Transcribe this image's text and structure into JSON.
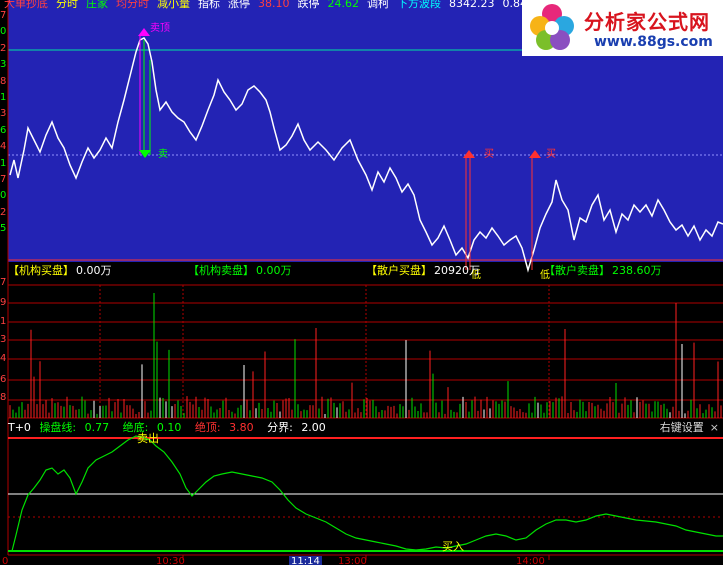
{
  "header": {
    "items": [
      {
        "text": "大单抄底",
        "color": "#ff4040"
      },
      {
        "text": "分时",
        "color": "#ffff00"
      },
      {
        "text": "庄家",
        "color": "#00ff00"
      },
      {
        "text": "均分时",
        "color": "#ff4040"
      },
      {
        "text": "减小量",
        "color": "#ffff00"
      },
      {
        "text": "指标",
        "color": "#ffffff"
      },
      {
        "text": "涨停",
        "color": "#ffffff"
      },
      {
        "text": "38.10",
        "color": "#ff4040"
      },
      {
        "text": "跌停",
        "color": "#ffffff"
      },
      {
        "text": "24.62",
        "color": "#00ff00"
      },
      {
        "text": "调柯",
        "color": "#ffffff"
      },
      {
        "text": "下方波段",
        "color": "#00ffff"
      },
      {
        "text": "8342.23",
        "color": "#ffffff"
      },
      {
        "text": "0.84",
        "color": "#ffffff"
      }
    ]
  },
  "logo": {
    "title": "分析家公式网",
    "url": "www.88gs.com"
  },
  "annotations": {
    "top": "卖顶",
    "sell": "卖",
    "buy1": "买",
    "buy2": "买",
    "base1": "低",
    "base2": "低"
  },
  "summary": [
    {
      "label": "【机构买盘】",
      "value": "0.00万",
      "label_color": "#ffff00",
      "value_color": "#ffffff"
    },
    {
      "label": "【机构卖盘】",
      "value": "0.00万",
      "label_color": "#00ff00",
      "value_color": "#00ff00"
    },
    {
      "label": "【散户买盘】",
      "value": "20920万",
      "label_color": "#ffff00",
      "value_color": "#ffffff"
    },
    {
      "label": "【散户卖盘】",
      "value": "238.60万",
      "label_color": "#00ff00",
      "value_color": "#00ff00"
    }
  ],
  "indicator": {
    "name": "T+0",
    "params": [
      {
        "label": "操盘线:",
        "value": "0.77",
        "color": "#00ff00"
      },
      {
        "label": "绝底:",
        "value": "0.10",
        "color": "#00ff00"
      },
      {
        "label": "绝顶:",
        "value": "3.80",
        "color": "#ff3030"
      },
      {
        "label": "分界:",
        "value": "2.00",
        "color": "#ffffff"
      }
    ],
    "settings_label": "右键设置",
    "close_label": "×",
    "sell_label": "卖出",
    "buy_label": "买入"
  },
  "x_axis": {
    "labels": [
      "0",
      "10:30",
      "13:00",
      "14:00"
    ],
    "cursor_time": "11:14"
  },
  "y_axis": {
    "price_labels": [
      "7",
      "0",
      "2",
      "3",
      "8",
      "1",
      "3",
      "6",
      "4",
      "1",
      "7",
      "0",
      "2",
      "5"
    ],
    "volume_labels": [
      "7",
      "9",
      "1",
      "3",
      "4",
      "6",
      "8"
    ]
  },
  "colors": {
    "price_line": "#ffffff",
    "price_bg": "#2323b4",
    "grid_red": "#b00000",
    "indicator_line": "#00e000",
    "bar_red": "#ff2020",
    "bar_green": "#00e000",
    "bar_white": "#ffffff"
  }
}
